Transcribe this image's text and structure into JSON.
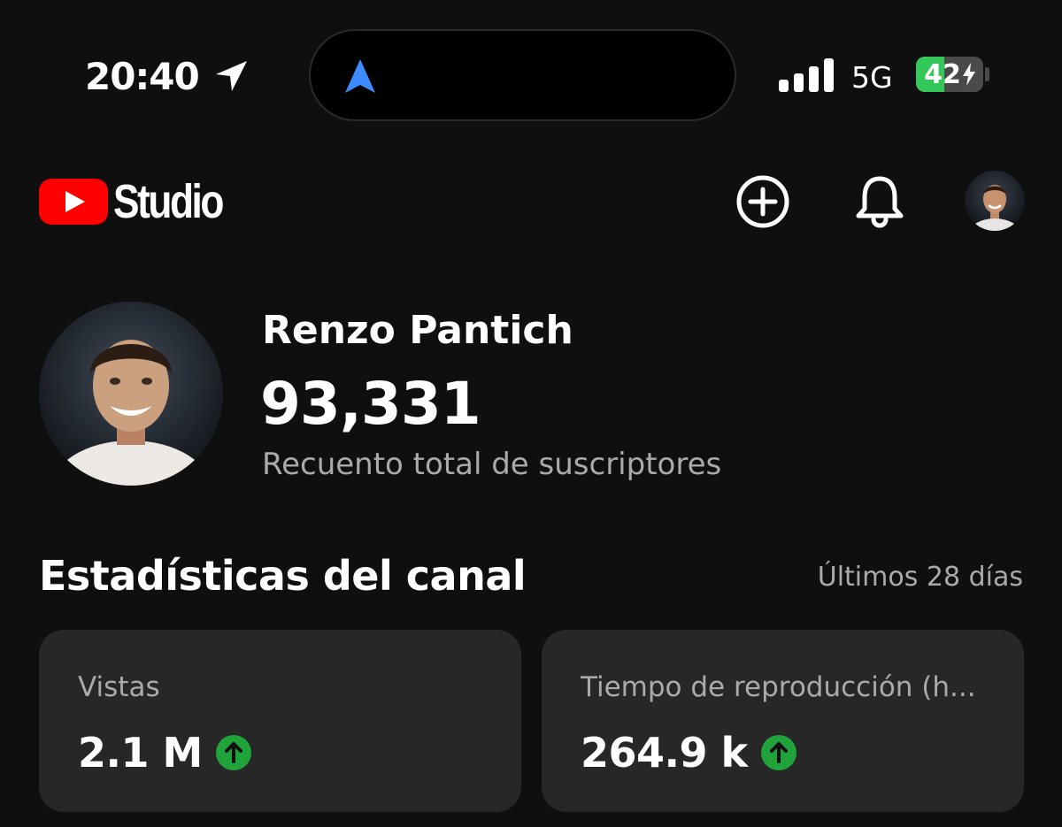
{
  "status_bar": {
    "time": "20:40",
    "network": "5G",
    "battery_level": "42",
    "battery_fraction": 0.42
  },
  "header": {
    "app_name": "Studio",
    "brand_color": "#ff0000",
    "icons": [
      "youtube-logo-icon",
      "create-icon",
      "bell-icon",
      "avatar"
    ]
  },
  "channel": {
    "name": "Renzo Pantich",
    "subscriber_count": "93,331",
    "subscriber_label": "Recuento total de suscriptores"
  },
  "stats": {
    "title": "Estadísticas del canal",
    "period": "Últimos 28 días",
    "trend_color": "#1fa33a",
    "cards": [
      {
        "label": "Vistas",
        "value": "2.1 M",
        "trend": "up"
      },
      {
        "label": "Tiempo de reproducción (h...",
        "value": "264.9 k",
        "trend": "up"
      }
    ]
  }
}
